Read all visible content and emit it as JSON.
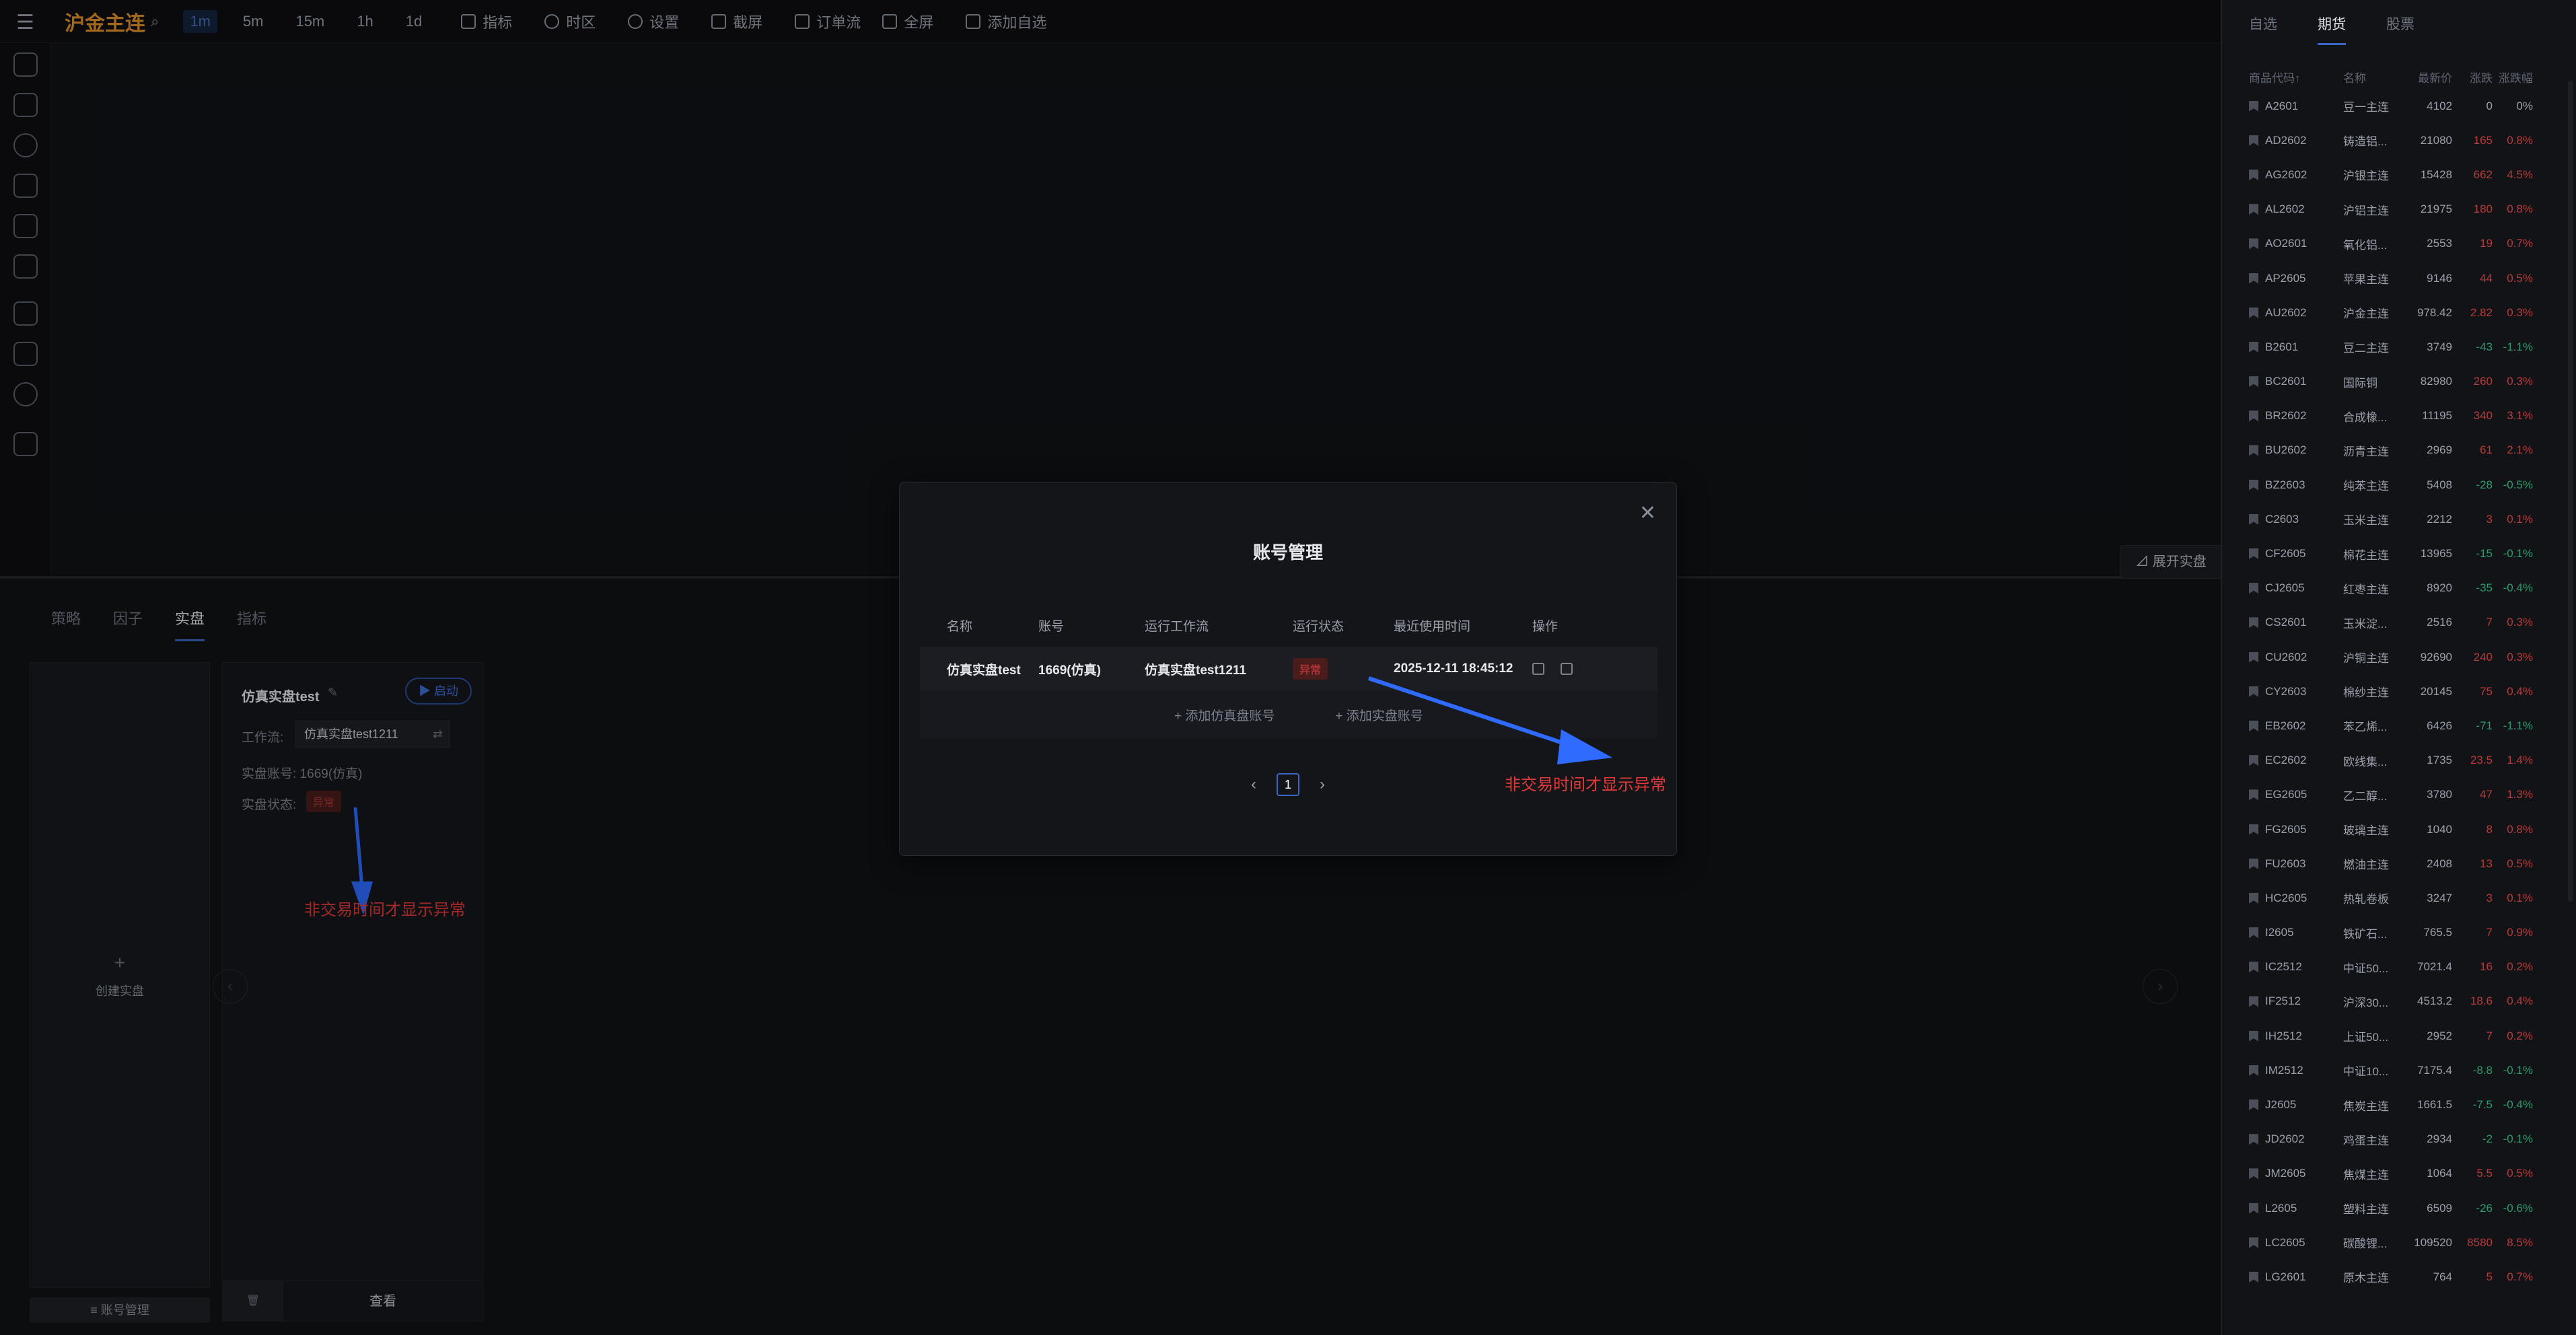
{
  "toolbar": {
    "symbol": "沪金主连",
    "timeframes": [
      "1m",
      "5m",
      "15m",
      "1h",
      "1d"
    ],
    "active_timeframe": "1m",
    "tools": [
      "指标",
      "时区",
      "设置",
      "截屏",
      "订单流",
      "全屏",
      "添加自选"
    ]
  },
  "bottom": {
    "tabs": [
      "策略",
      "因子",
      "实盘",
      "指标"
    ],
    "active_tab": "实盘",
    "create_label": "创建实盘",
    "account_mgmt_label": "≡ 账号管理",
    "expand_label": "展开实盘",
    "live_card": {
      "name": "仿真实盘test",
      "start_label": "启动",
      "workflow_label": "工作流:",
      "workflow_value": "仿真实盘test1211",
      "account_label": "实盘账号: 1669(仿真)",
      "status_label": "实盘状态:",
      "status_value": "异常",
      "view_label": "查看"
    },
    "annotation": "非交易时间才显示异常"
  },
  "modal": {
    "title": "账号管理",
    "headers": [
      "名称",
      "账号",
      "运行工作流",
      "运行状态",
      "最近使用时间",
      "操作"
    ],
    "row": {
      "name": "仿真实盘test",
      "account": "1669(仿真)",
      "workflow": "仿真实盘test1211",
      "status": "异常",
      "last_used": "2025-12-11 18:45:12"
    },
    "add_sim": "+ 添加仿真盘账号",
    "add_live": "+ 添加实盘账号",
    "page": "1",
    "annotation": "非交易时间才显示异常"
  },
  "sidebar": {
    "tabs": [
      "自选",
      "期货",
      "股票"
    ],
    "active_tab": "期货",
    "headers": [
      "商品代码↑",
      "名称",
      "最新价",
      "涨跌",
      "涨跌幅"
    ],
    "rows": [
      [
        "A2601",
        "豆一主连",
        "4102",
        "0",
        "0%",
        "flat"
      ],
      [
        "AD2602",
        "铸造铝...",
        "21080",
        "165",
        "0.8%",
        "up"
      ],
      [
        "AG2602",
        "沪银主连",
        "15428",
        "662",
        "4.5%",
        "up"
      ],
      [
        "AL2602",
        "沪铝主连",
        "21975",
        "180",
        "0.8%",
        "up"
      ],
      [
        "AO2601",
        "氧化铝...",
        "2553",
        "19",
        "0.7%",
        "up"
      ],
      [
        "AP2605",
        "苹果主连",
        "9146",
        "44",
        "0.5%",
        "up"
      ],
      [
        "AU2602",
        "沪金主连",
        "978.42",
        "2.82",
        "0.3%",
        "up"
      ],
      [
        "B2601",
        "豆二主连",
        "3749",
        "-43",
        "-1.1%",
        "down"
      ],
      [
        "BC2601",
        "国际铜",
        "82980",
        "260",
        "0.3%",
        "up"
      ],
      [
        "BR2602",
        "合成橡...",
        "11195",
        "340",
        "3.1%",
        "up"
      ],
      [
        "BU2602",
        "沥青主连",
        "2969",
        "61",
        "2.1%",
        "up"
      ],
      [
        "BZ2603",
        "纯苯主连",
        "5408",
        "-28",
        "-0.5%",
        "down"
      ],
      [
        "C2603",
        "玉米主连",
        "2212",
        "3",
        "0.1%",
        "up"
      ],
      [
        "CF2605",
        "棉花主连",
        "13965",
        "-15",
        "-0.1%",
        "down"
      ],
      [
        "CJ2605",
        "红枣主连",
        "8920",
        "-35",
        "-0.4%",
        "down"
      ],
      [
        "CS2601",
        "玉米淀...",
        "2516",
        "7",
        "0.3%",
        "up"
      ],
      [
        "CU2602",
        "沪铜主连",
        "92690",
        "240",
        "0.3%",
        "up"
      ],
      [
        "CY2603",
        "棉纱主连",
        "20145",
        "75",
        "0.4%",
        "up"
      ],
      [
        "EB2602",
        "苯乙烯...",
        "6426",
        "-71",
        "-1.1%",
        "down"
      ],
      [
        "EC2602",
        "欧线集...",
        "1735",
        "23.5",
        "1.4%",
        "up"
      ],
      [
        "EG2605",
        "乙二醇...",
        "3780",
        "47",
        "1.3%",
        "up"
      ],
      [
        "FG2605",
        "玻璃主连",
        "1040",
        "8",
        "0.8%",
        "up"
      ],
      [
        "FU2603",
        "燃油主连",
        "2408",
        "13",
        "0.5%",
        "up"
      ],
      [
        "HC2605",
        "热轧卷板",
        "3247",
        "3",
        "0.1%",
        "up"
      ],
      [
        "I2605",
        "铁矿石...",
        "765.5",
        "7",
        "0.9%",
        "up"
      ],
      [
        "IC2512",
        "中证50...",
        "7021.4",
        "16",
        "0.2%",
        "up"
      ],
      [
        "IF2512",
        "沪深30...",
        "4513.2",
        "18.6",
        "0.4%",
        "up"
      ],
      [
        "IH2512",
        "上证50...",
        "2952",
        "7",
        "0.2%",
        "up"
      ],
      [
        "IM2512",
        "中证10...",
        "7175.4",
        "-8.8",
        "-0.1%",
        "down"
      ],
      [
        "J2605",
        "焦炭主连",
        "1661.5",
        "-7.5",
        "-0.4%",
        "down"
      ],
      [
        "JD2602",
        "鸡蛋主连",
        "2934",
        "-2",
        "-0.1%",
        "down"
      ],
      [
        "JM2605",
        "焦煤主连",
        "1064",
        "5.5",
        "0.5%",
        "up"
      ],
      [
        "L2605",
        "塑料主连",
        "6509",
        "-26",
        "-0.6%",
        "down"
      ],
      [
        "LC2605",
        "碳酸锂...",
        "109520",
        "8580",
        "8.5%",
        "up"
      ],
      [
        "LG2601",
        "原木主连",
        "764",
        "5",
        "0.7%",
        "up"
      ]
    ]
  }
}
